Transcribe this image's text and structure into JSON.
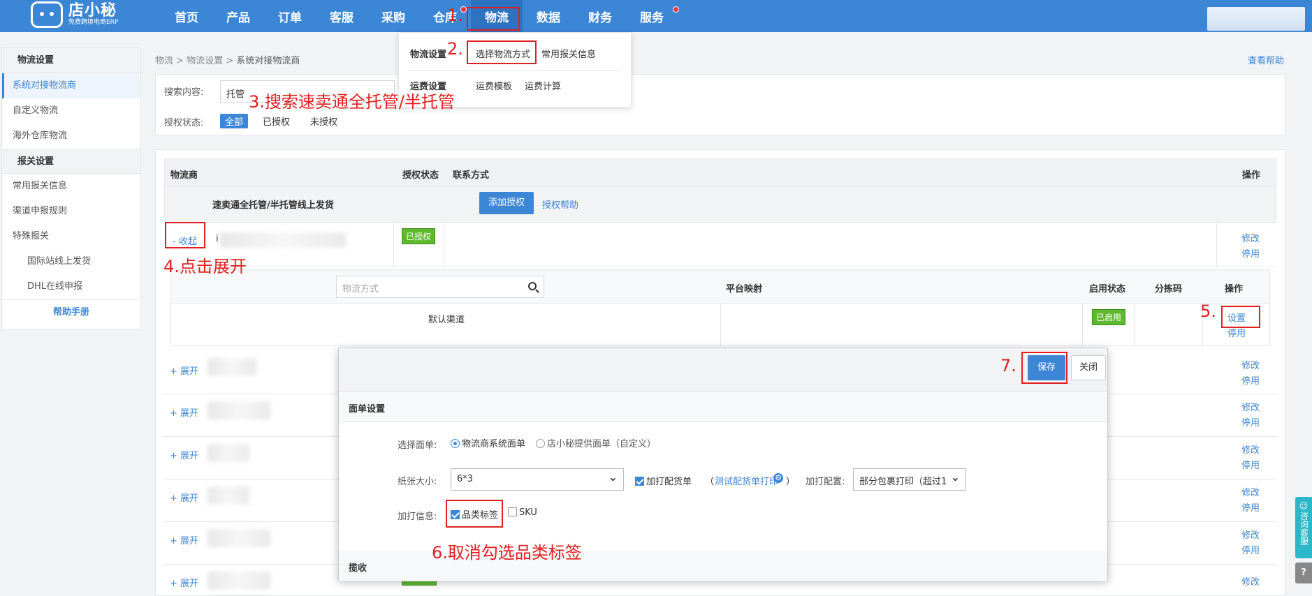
{
  "header": {
    "logo_title": "店小秘",
    "logo_sub": "免费跨境电商ERP",
    "nav": [
      "首页",
      "产品",
      "订单",
      "客服",
      "采购",
      "仓库",
      "物流",
      "数据",
      "财务",
      "服务"
    ]
  },
  "dropdown": {
    "g1_label": "物流设置",
    "g1_items": [
      "选择物流方式",
      "常用报关信息"
    ],
    "g2_label": "运费设置",
    "g2_items": [
      "运费模板",
      "运费计算"
    ]
  },
  "sidebar": {
    "group1": "物流设置",
    "items1": [
      "系统对接物流商",
      "自定义物流",
      "海外仓库物流"
    ],
    "group2": "报关设置",
    "items2": [
      "常用报关信息",
      "渠道申报规则",
      "特殊报关"
    ],
    "sub_items": [
      "国际站线上发货",
      "DHL在线申报"
    ],
    "help": "帮助手册"
  },
  "breadcrumb": {
    "p1": "物流",
    "p2": "物流设置",
    "p3": "系统对接物流商",
    "sep": ">"
  },
  "help_link": "查看帮助",
  "filter": {
    "search_label": "搜索内容:",
    "search_value": "托管",
    "auth_label": "授权状态:",
    "tabs": [
      "全部",
      "已授权",
      "未授权"
    ]
  },
  "table": {
    "headers": [
      "物流商",
      "授权状态",
      "联系方式",
      "操作"
    ],
    "group_name": "速卖通全托管/半托管线上发货",
    "add_auth": "添加授权",
    "auth_help": "授权帮助",
    "collapse": "- 收起",
    "expand": "+ 展开",
    "authorized": "已授权",
    "edit": "修改",
    "disable": "停用",
    "row1_account": "i"
  },
  "subtable": {
    "search_placeholder": "物流方式",
    "headers": [
      "平台映射",
      "启用状态",
      "分拣码",
      "操作"
    ],
    "channel": "默认渠道",
    "enabled": "已启用",
    "settings": "设置",
    "disable": "停用"
  },
  "modal": {
    "save": "保存",
    "close": "关闭",
    "section1": "面单设置",
    "select_label": "选择面单:",
    "radio1": "物流商系统面单",
    "radio2": "店小秘提供面单（自定义）",
    "paper_label": "纸张大小:",
    "paper_value": "6*3",
    "pick_print": "加打配货单",
    "paren_open": "（",
    "paren_close": "）",
    "test_print": "测试配货单打印",
    "print_config_label": "加打配置:",
    "print_config_value": "部分包裹打印（超过1",
    "extra_label": "加打信息:",
    "category_label": "品类标签",
    "sku": "SKU",
    "section2": "揽收"
  },
  "annotations": {
    "a1": "1.",
    "a2": "2.",
    "a3": "3.搜索速卖通全托管/半托管",
    "a4": "4.点击展开",
    "a5": "5.",
    "a6": "6.取消勾选品类标签",
    "a7": "7."
  },
  "widget": {
    "consult": "咨询客服",
    "help": "?"
  },
  "colors": {
    "brand": "#3c86d6",
    "annotation": "#e02020",
    "enabled": "#5fb92f"
  }
}
